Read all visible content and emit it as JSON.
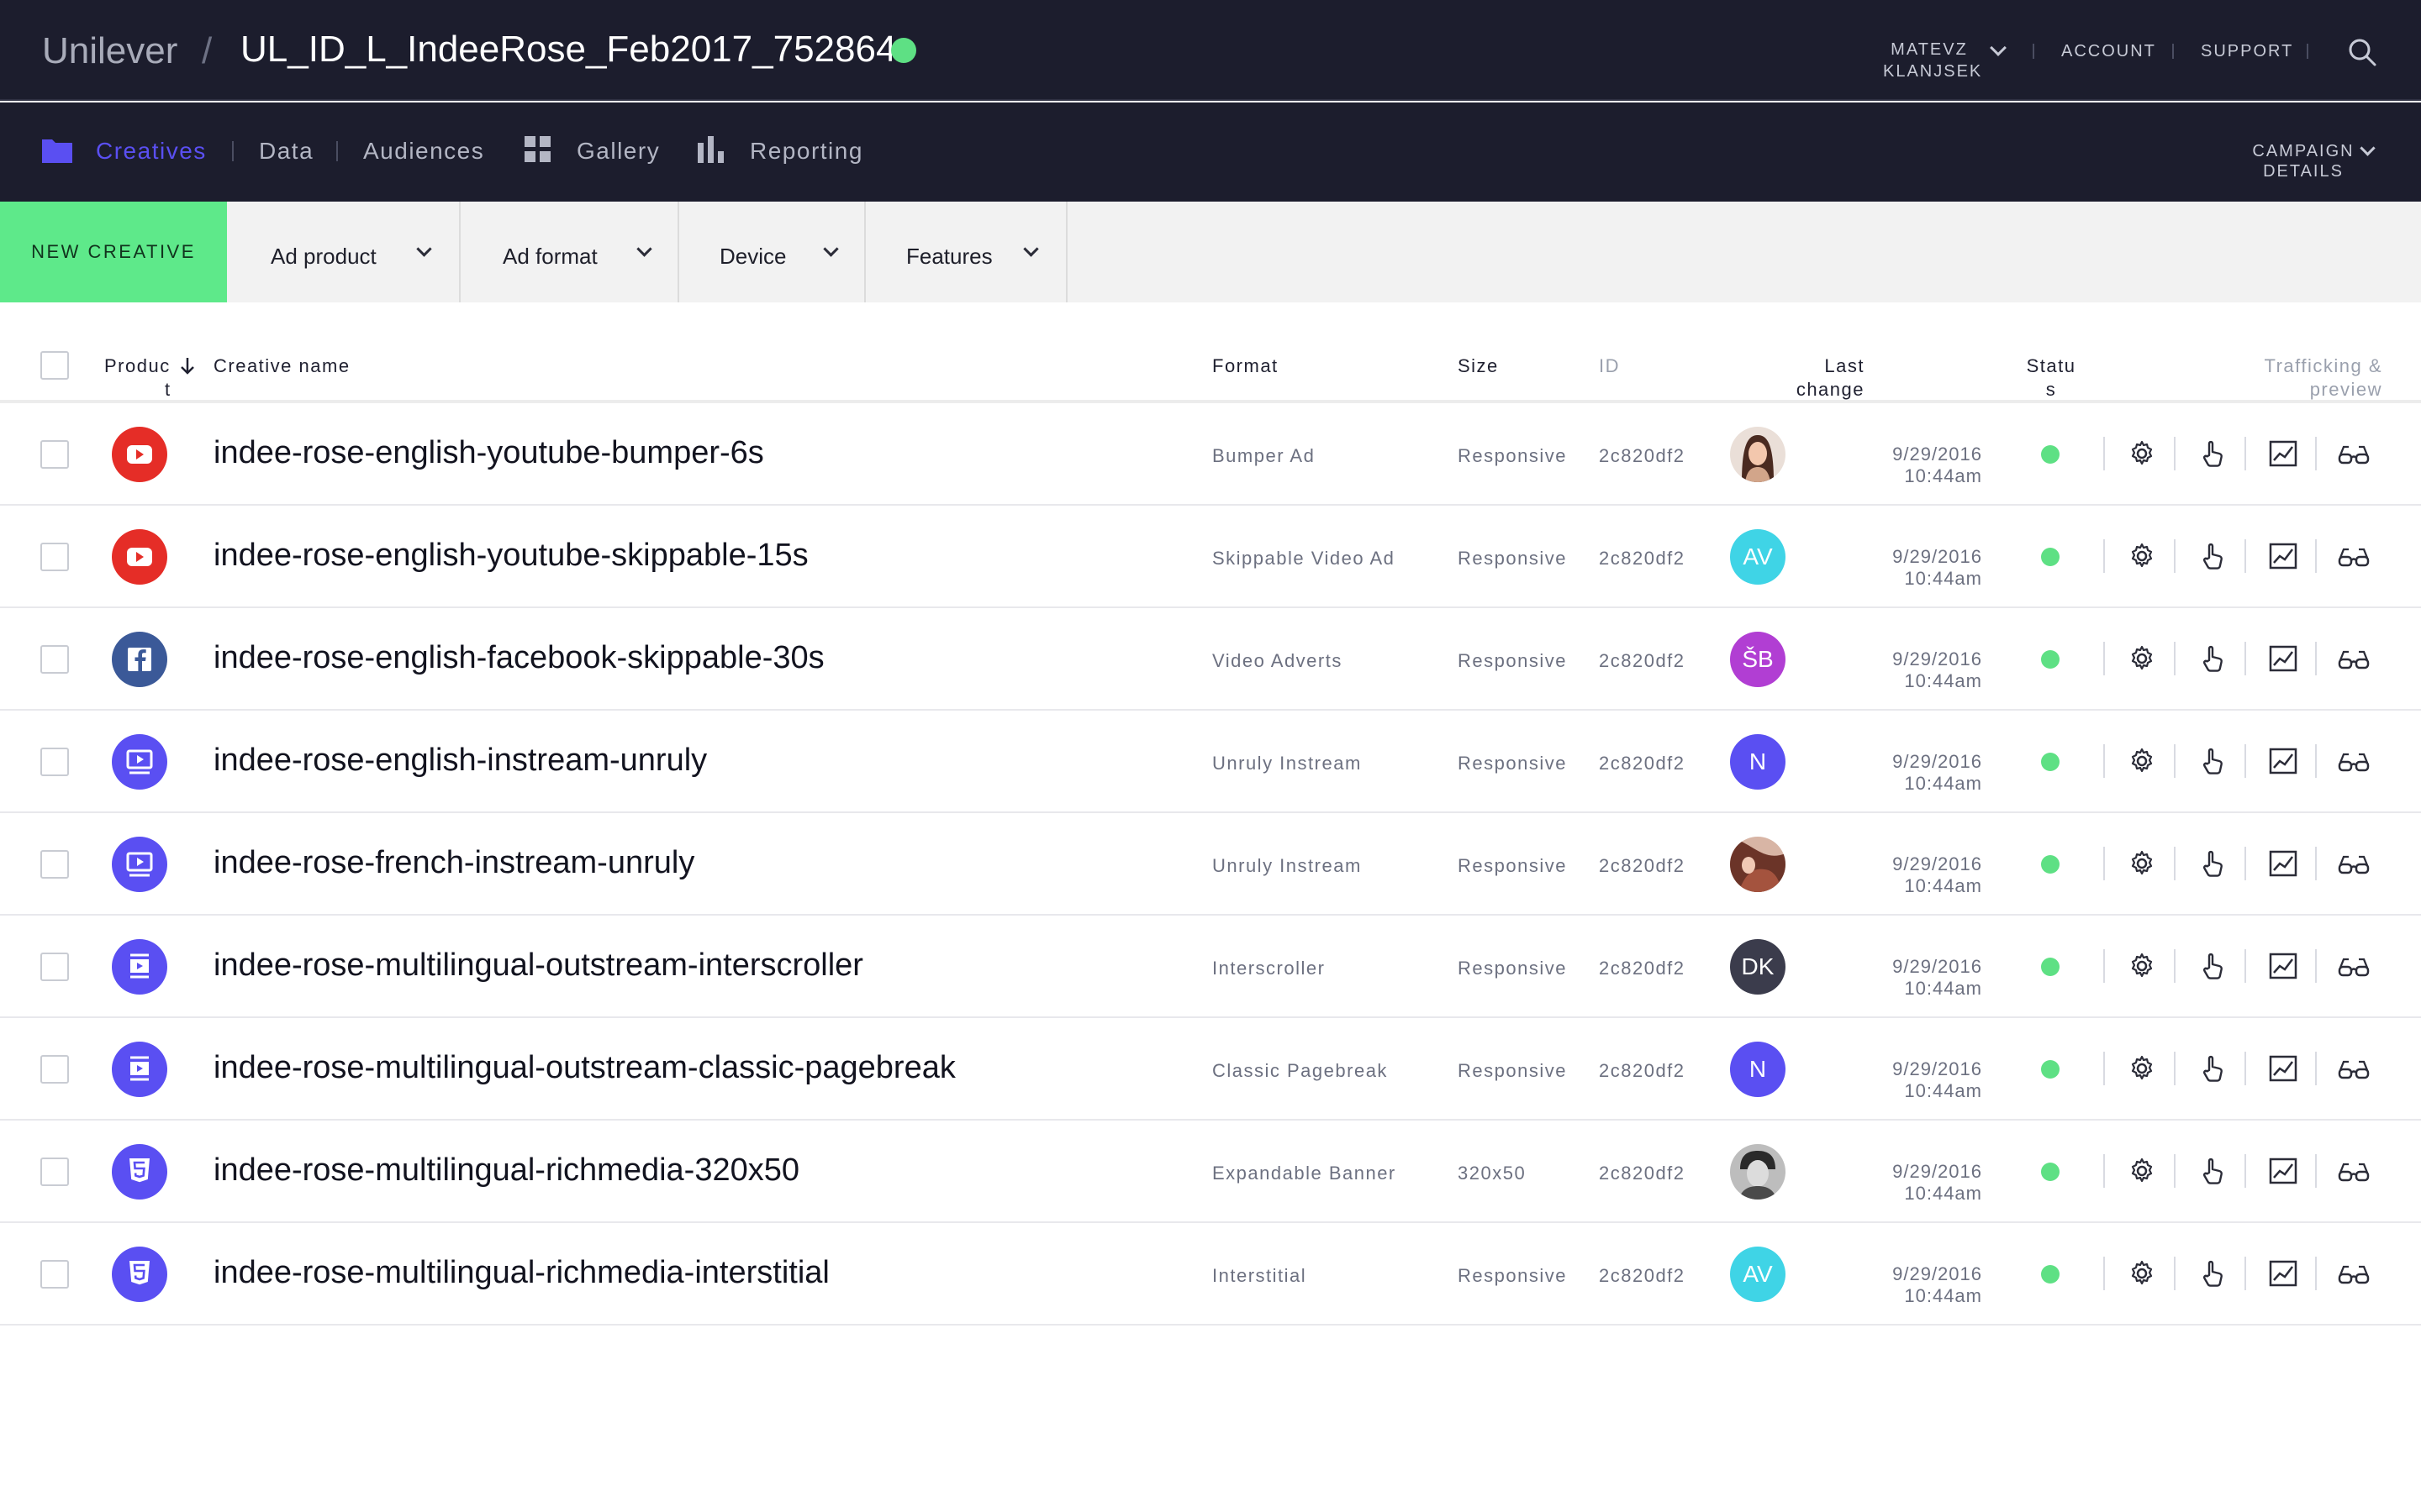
{
  "header": {
    "brand": "Unilever",
    "separator": "/",
    "campaign_name": "UL_ID_L_IndeeRose_Feb2017_752864",
    "user_first": "MATEVZ",
    "user_last": "KLANJSEK",
    "account_label": "ACCOUNT",
    "support_label": "SUPPORT"
  },
  "nav": {
    "creatives": "Creatives",
    "data": "Data",
    "audiences": "Audiences",
    "gallery": "Gallery",
    "reporting": "Reporting",
    "campaign_details_1": "CAMPAIGN",
    "campaign_details_2": "DETAILS"
  },
  "toolbar": {
    "new_creative": "NEW CREATIVE",
    "filters": [
      "Ad product",
      "Ad format",
      "Device",
      "Features"
    ]
  },
  "table": {
    "columns": {
      "product_1": "Produc",
      "product_2": "t",
      "name": "Creative name",
      "format": "Format",
      "size": "Size",
      "id": "ID",
      "last_change_1": "Last",
      "last_change_2": "change",
      "status_1": "Statu",
      "status_2": "s",
      "trafficking_1": "Trafficking &",
      "trafficking_2": "preview"
    },
    "rows": [
      {
        "name": "indee-rose-english-youtube-bumper-6s",
        "product_icon": "youtube-icon",
        "format": "Bumper Ad",
        "size": "Responsive",
        "id": "2c820df2",
        "avatar_type": "photo-woman",
        "avatar_text": "",
        "date": "9/29/2016",
        "time": "10:44am"
      },
      {
        "name": "indee-rose-english-youtube-skippable-15s",
        "product_icon": "youtube-icon",
        "format": "Skippable Video Ad",
        "size": "Responsive",
        "id": "2c820df2",
        "avatar_type": "initials",
        "avatar_text": "AV",
        "avatar_color": "#3fd4e6",
        "date": "9/29/2016",
        "time": "10:44am"
      },
      {
        "name": "indee-rose-english-facebook-skippable-30s",
        "product_icon": "facebook-icon",
        "format": "Video Adverts",
        "size": "Responsive",
        "id": "2c820df2",
        "avatar_type": "initials",
        "avatar_text": "ŠB",
        "avatar_color": "#b13ed3",
        "date": "9/29/2016",
        "time": "10:44am"
      },
      {
        "name": "indee-rose-english-instream-unruly",
        "product_icon": "instream-icon",
        "format": "Unruly Instream",
        "size": "Responsive",
        "id": "2c820df2",
        "avatar_type": "initials",
        "avatar_text": "N",
        "avatar_color": "#5a4ff2",
        "date": "9/29/2016",
        "time": "10:44am"
      },
      {
        "name": "indee-rose-french-instream-unruly",
        "product_icon": "instream-icon",
        "format": "Unruly Instream",
        "size": "Responsive",
        "id": "2c820df2",
        "avatar_type": "photo-hair",
        "avatar_text": "",
        "date": "9/29/2016",
        "time": "10:44am"
      },
      {
        "name": "indee-rose-multilingual-outstream-interscroller",
        "product_icon": "outstream-icon",
        "format": "Interscroller",
        "size": "Responsive",
        "id": "2c820df2",
        "avatar_type": "initials",
        "avatar_text": "DK",
        "avatar_color": "#3b3c4c",
        "date": "9/29/2016",
        "time": "10:44am"
      },
      {
        "name": "indee-rose-multilingual-outstream-classic-pagebreak",
        "product_icon": "outstream-icon",
        "format": "Classic Pagebreak",
        "size": "Responsive",
        "id": "2c820df2",
        "avatar_type": "initials",
        "avatar_text": "N",
        "avatar_color": "#5a4ff2",
        "date": "9/29/2016",
        "time": "10:44am"
      },
      {
        "name": "indee-rose-multilingual-richmedia-320x50",
        "product_icon": "html5-icon",
        "format": "Expandable Banner",
        "size": "320x50",
        "id": "2c820df2",
        "avatar_type": "photo-man",
        "avatar_text": "",
        "date": "9/29/2016",
        "time": "10:44am"
      },
      {
        "name": "indee-rose-multilingual-richmedia-interstitial",
        "product_icon": "html5-icon",
        "format": "Interstitial",
        "size": "Responsive",
        "id": "2c820df2",
        "avatar_type": "initials",
        "avatar_text": "AV",
        "avatar_color": "#3fd4e6",
        "date": "9/29/2016",
        "time": "10:44am"
      }
    ]
  },
  "colors": {
    "accent": "#5a4ff2",
    "status_active": "#5ee084",
    "new_creative_bg": "#5ee98a",
    "header_bg": "#1c1d2d",
    "youtube_red": "#e52d27",
    "facebook_blue": "#3b5998"
  }
}
